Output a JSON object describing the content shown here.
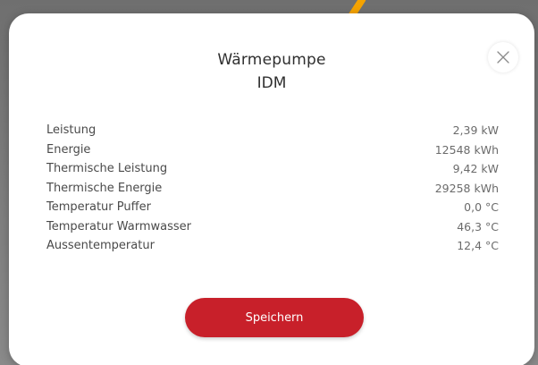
{
  "modal": {
    "title": "Wärmepumpe",
    "subtitle": "IDM",
    "close_icon": "close-icon",
    "rows": [
      {
        "label": "Leistung",
        "value": "2,39 kW"
      },
      {
        "label": "Energie",
        "value": "12548 kWh"
      },
      {
        "label": "Thermische Leistung",
        "value": "9,42 kW"
      },
      {
        "label": "Thermische Energie",
        "value": "29258 kWh"
      },
      {
        "label": "Temperatur Puffer",
        "value": "0,0 °C"
      },
      {
        "label": "Temperatur Warmwasser",
        "value": "46,3 °C"
      },
      {
        "label": "Aussentemperatur",
        "value": "12,4 °C"
      }
    ],
    "save_label": "Speichern"
  },
  "colors": {
    "primary_button": "#c8202a",
    "accent_line": "#f5a300",
    "backdrop": "#7a7a7a"
  }
}
